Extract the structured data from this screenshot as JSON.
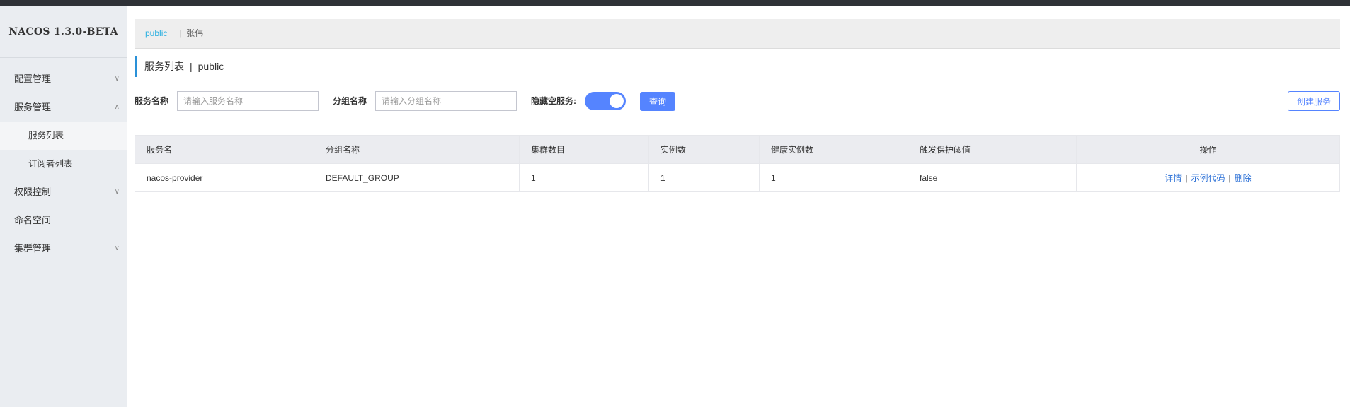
{
  "app": {
    "title": "NACOS 1.3.0-BETA"
  },
  "sidebar": {
    "items": [
      {
        "label": "配置管理",
        "chevron": "chevron-down"
      },
      {
        "label": "服务管理",
        "chevron": "chevron-up"
      },
      {
        "label": "服务列表",
        "active": true
      },
      {
        "label": "订阅者列表"
      },
      {
        "label": "权限控制",
        "chevron": "chevron-down"
      },
      {
        "label": "命名空间"
      },
      {
        "label": "集群管理",
        "chevron": "chevron-down"
      }
    ]
  },
  "breadcrumb": {
    "namespace": "public",
    "separator": "|",
    "user": "张伟"
  },
  "page": {
    "title": "服务列表",
    "divider": "|",
    "namespace": "public"
  },
  "filters": {
    "service_name_label": "服务名称",
    "service_name_placeholder": "请输入服务名称",
    "group_name_label": "分组名称",
    "group_name_placeholder": "请输入分组名称",
    "hide_empty_label": "隐藏空服务:",
    "hide_empty_on": true,
    "query_label": "查询",
    "create_label": "创建服务"
  },
  "table": {
    "columns": [
      "服务名",
      "分组名称",
      "集群数目",
      "实例数",
      "健康实例数",
      "触发保护阈值",
      "操作"
    ],
    "rows": [
      {
        "service": "nacos-provider",
        "group": "DEFAULT_GROUP",
        "clusters": "1",
        "instances": "1",
        "healthy": "1",
        "threshold": "false",
        "actions": [
          "详情",
          "示例代码",
          "删除"
        ]
      }
    ]
  },
  "colors": {
    "primary": "#5584ff",
    "link": "#2a6fd6",
    "namespace": "#2cb0e0",
    "accent_bar": "#2a91d8"
  }
}
